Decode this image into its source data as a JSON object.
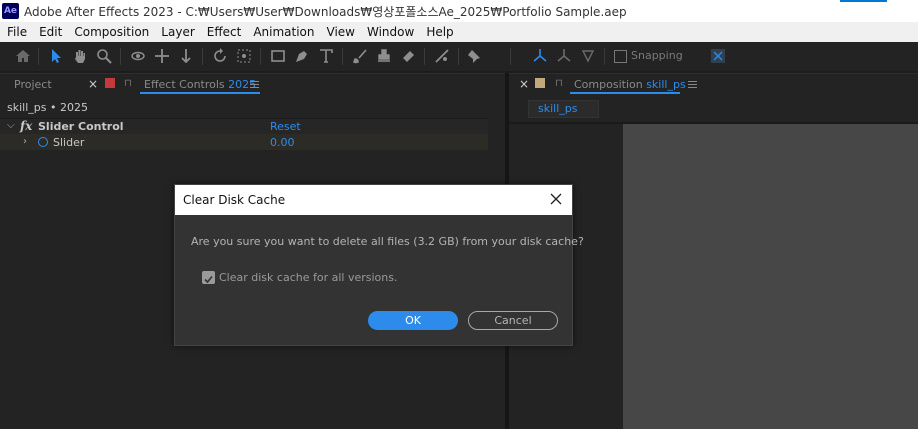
{
  "window": {
    "app_icon_text": "Ae",
    "title": "Adobe After Effects 2023 - C:₩Users₩User₩Downloads₩영상포폴소스Ae_2025₩Portfolio Sample.aep"
  },
  "menu": [
    "File",
    "Edit",
    "Composition",
    "Layer",
    "Effect",
    "Animation",
    "View",
    "Window",
    "Help"
  ],
  "toolbar": {
    "snapping_label": "Snapping",
    "tools": [
      "home-icon",
      "selection-tool-icon",
      "hand-tool-icon",
      "zoom-tool-icon",
      "orbit-camera-icon",
      "pan-camera-icon",
      "dolly-camera-icon",
      "rotation-tool-icon",
      "pan-behind-icon",
      "rectangle-tool-icon",
      "pen-tool-icon",
      "type-tool-icon",
      "brush-tool-icon",
      "clone-stamp-icon",
      "eraser-tool-icon",
      "roto-brush-icon",
      "puppet-pin-icon",
      "axis-local-icon",
      "axis-world-icon",
      "axis-view-icon",
      "snap-magnet-icon"
    ]
  },
  "left_panel": {
    "tab_project": "Project",
    "tab_effect_controls_label": "Effect Controls",
    "tab_effect_controls_comp": "2025",
    "header": "skill_ps • 2025",
    "effect": {
      "name": "Slider Control",
      "reset": "Reset",
      "property": "Slider",
      "value": "0.00"
    }
  },
  "right_panel": {
    "tab_label": "Composition",
    "tab_comp": "skill_ps",
    "subtab": "skill_ps"
  },
  "dialog": {
    "title": "Clear Disk Cache",
    "message": "Are you sure you want to delete all files (3.2 GB) from your disk cache?",
    "checkbox_label": "Clear disk cache for all versions.",
    "checkbox_checked": true,
    "ok_label": "OK",
    "cancel_label": "Cancel"
  },
  "colors": {
    "accent": "#2d8ceb",
    "project_swatch": "#c43a3a",
    "comp_swatch": "#c2a87a"
  }
}
